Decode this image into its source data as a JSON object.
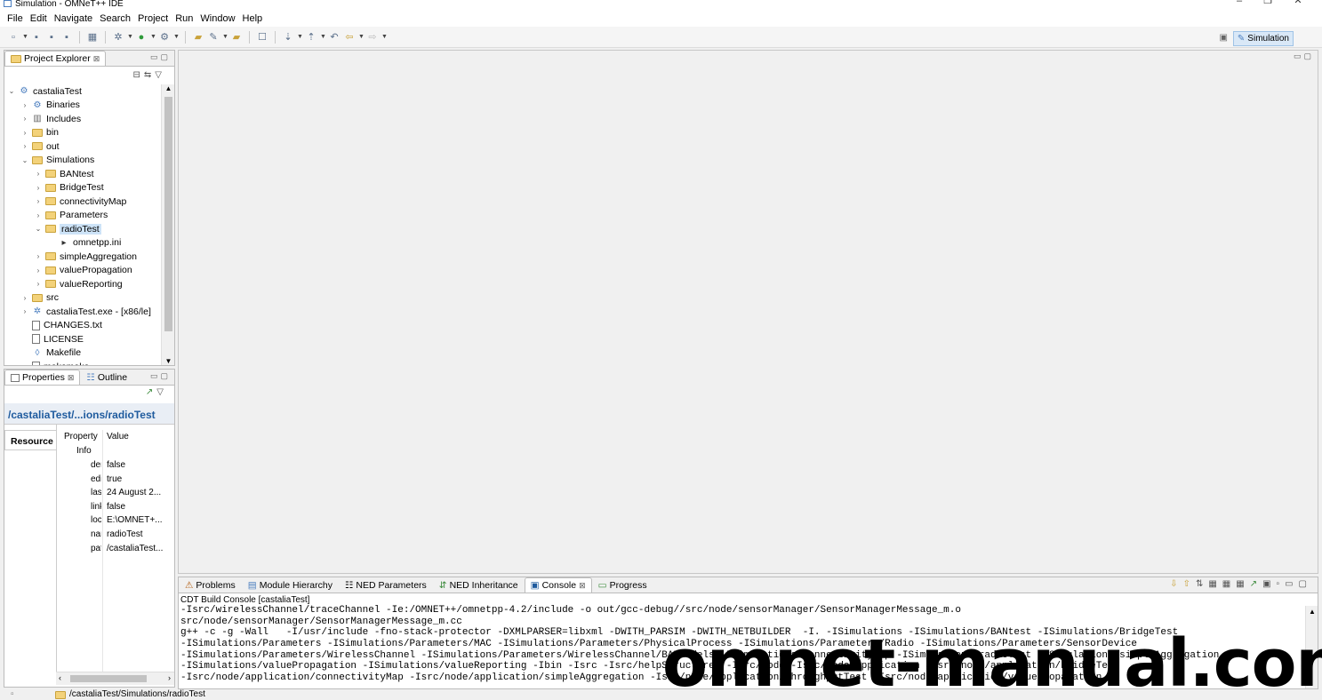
{
  "window": {
    "title": "Simulation - OMNeT++ IDE",
    "controls": [
      "–",
      "❐",
      "✕"
    ]
  },
  "menu": [
    "File",
    "Edit",
    "Navigate",
    "Search",
    "Project",
    "Run",
    "Window",
    "Help"
  ],
  "perspective": {
    "label": "Simulation"
  },
  "project_explorer": {
    "tab_label": "Project Explorer",
    "tree": [
      {
        "label": "castaliaTest",
        "depth": 0,
        "expanded": true,
        "icon": "project-icon"
      },
      {
        "label": "Binaries",
        "depth": 1,
        "expanded": false,
        "icon": "binaries-icon"
      },
      {
        "label": "Includes",
        "depth": 1,
        "expanded": false,
        "icon": "includes-icon"
      },
      {
        "label": "bin",
        "depth": 1,
        "expanded": false,
        "icon": "folder-icon"
      },
      {
        "label": "out",
        "depth": 1,
        "expanded": false,
        "icon": "folder-icon"
      },
      {
        "label": "Simulations",
        "depth": 1,
        "expanded": true,
        "icon": "folder-icon"
      },
      {
        "label": "BANtest",
        "depth": 2,
        "expanded": false,
        "icon": "folder-icon"
      },
      {
        "label": "BridgeTest",
        "depth": 2,
        "expanded": false,
        "icon": "folder-icon"
      },
      {
        "label": "connectivityMap",
        "depth": 2,
        "expanded": false,
        "icon": "folder-icon"
      },
      {
        "label": "Parameters",
        "depth": 2,
        "expanded": false,
        "icon": "folder-icon"
      },
      {
        "label": "radioTest",
        "depth": 2,
        "expanded": true,
        "icon": "folder-icon",
        "selected": true
      },
      {
        "label": "omnetpp.ini",
        "depth": 3,
        "leaf": true,
        "icon": "ini-file-icon"
      },
      {
        "label": "simpleAggregation",
        "depth": 2,
        "expanded": false,
        "icon": "folder-icon"
      },
      {
        "label": "valuePropagation",
        "depth": 2,
        "expanded": false,
        "icon": "folder-icon"
      },
      {
        "label": "valueReporting",
        "depth": 2,
        "expanded": false,
        "icon": "folder-icon"
      },
      {
        "label": "src",
        "depth": 1,
        "expanded": false,
        "icon": "src-folder-icon"
      },
      {
        "label": "castaliaTest.exe - [x86/le]",
        "depth": 1,
        "expanded": false,
        "icon": "exe-icon"
      },
      {
        "label": "CHANGES.txt",
        "depth": 1,
        "leaf": true,
        "icon": "file-icon"
      },
      {
        "label": "LICENSE",
        "depth": 1,
        "leaf": true,
        "icon": "file-icon"
      },
      {
        "label": "Makefile",
        "depth": 1,
        "leaf": true,
        "icon": "makefile-icon"
      },
      {
        "label": "makemake",
        "depth": 1,
        "leaf": true,
        "icon": "file-icon"
      }
    ]
  },
  "properties": {
    "tabs": [
      "Properties",
      "Outline"
    ],
    "title": "/castaliaTest/...ions/radioTest",
    "category": "Resource",
    "col_property": "Property",
    "col_value": "Value",
    "group": "Info",
    "rows": [
      {
        "name": "der",
        "value": "false"
      },
      {
        "name": "edi",
        "value": "true"
      },
      {
        "name": "last",
        "value": "24 August 2..."
      },
      {
        "name": "link",
        "value": "false"
      },
      {
        "name": "loc",
        "value": "E:\\OMNET+..."
      },
      {
        "name": "nar",
        "value": "radioTest"
      },
      {
        "name": "pat",
        "value": "/castaliaTest..."
      }
    ]
  },
  "bottom_tabs": [
    "Problems",
    "Module Hierarchy",
    "NED Parameters",
    "NED Inheritance",
    "Console",
    "Progress"
  ],
  "console": {
    "title": "CDT Build Console [castaliaTest]",
    "lines": [
      "-Isrc/wirelessChannel/traceChannel -Ie:/OMNET++/omnetpp-4.2/include -o out/gcc-debug//src/node/sensorManager/SensorManagerMessage_m.o",
      "src/node/sensorManager/SensorManagerMessage_m.cc",
      "g++ -c -g -Wall   -I/usr/include -fno-stack-protector -DXMLPARSER=libxml -DWITH_PARSIM -DWITH_NETBUILDER  -I. -ISimulations -ISimulations/BANtest -ISimulations/BridgeTest",
      "-ISimulations/Parameters -ISimulations/Parameters/MAC -ISimulations/Parameters/PhysicalProcess -ISimulations/Parameters/Radio -ISimulations/Parameters/SensorDevice",
      "-ISimulations/Parameters/WirelessChannel -ISimulations/Parameters/WirelessChannel/BANmodels -ISimulations/connectivityMap -ISimulations/radioTest -ISimulations/simpleAggregation",
      "-ISimulations/valuePropagation -ISimulations/valueReporting -Ibin -Isrc -Isrc/helpStructures -Isrc/node -Isrc/node/application -Isrc/node/application/bridgeTest",
      "-Isrc/node/application/connectivityMap -Isrc/node/application/simpleAggregation -Isrc/node/application/throughputTest -Isrc/node/application/valuePropagation"
    ]
  },
  "status": {
    "path": "/castaliaTest/Simulations/radioTest"
  },
  "watermark": "omnet-manual.com"
}
